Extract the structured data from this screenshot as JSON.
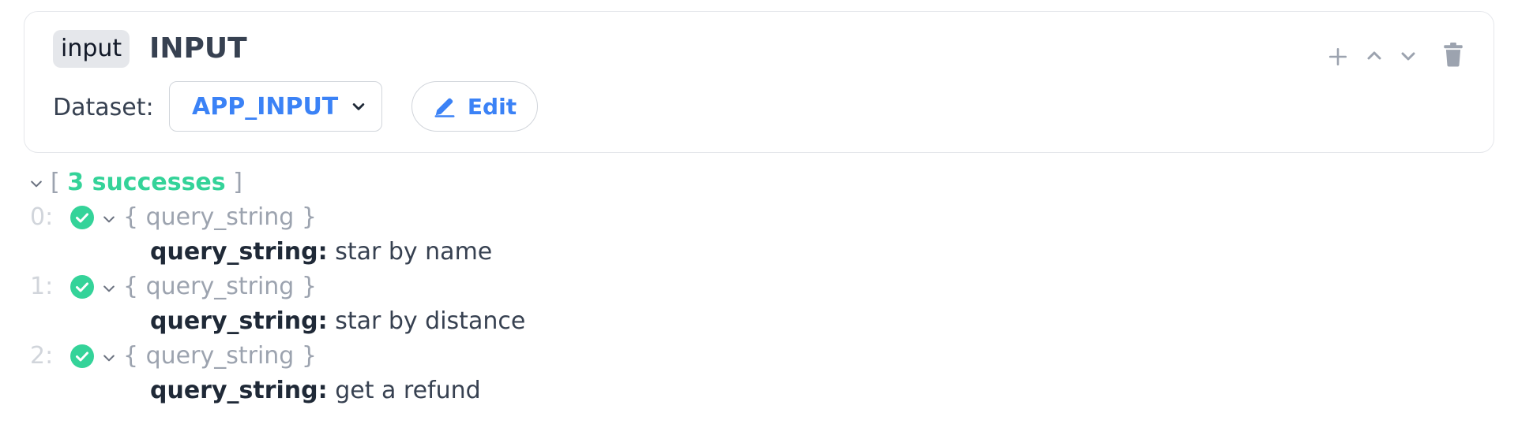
{
  "block": {
    "type_badge": "input",
    "title": "INPUT",
    "dataset_label": "Dataset:",
    "dataset_value": "APP_INPUT",
    "edit_label": "Edit",
    "toolbar": [
      "plus-icon",
      "chevron-up-icon",
      "chevron-down-icon",
      "trash-icon"
    ]
  },
  "results": {
    "open_bracket": "[",
    "success_count": "3 successes",
    "close_bracket": "]",
    "items": [
      {
        "index": "0:",
        "summary": "{ query_string }",
        "key": "query_string:",
        "value": "star by name"
      },
      {
        "index": "1:",
        "summary": "{ query_string }",
        "key": "query_string:",
        "value": "star by distance"
      },
      {
        "index": "2:",
        "summary": "{ query_string }",
        "key": "query_string:",
        "value": "get a refund"
      }
    ]
  },
  "colors": {
    "accent": "#3b82f6",
    "success": "#34d399",
    "muted": "#9ca3af",
    "border": "#e5e7eb"
  }
}
